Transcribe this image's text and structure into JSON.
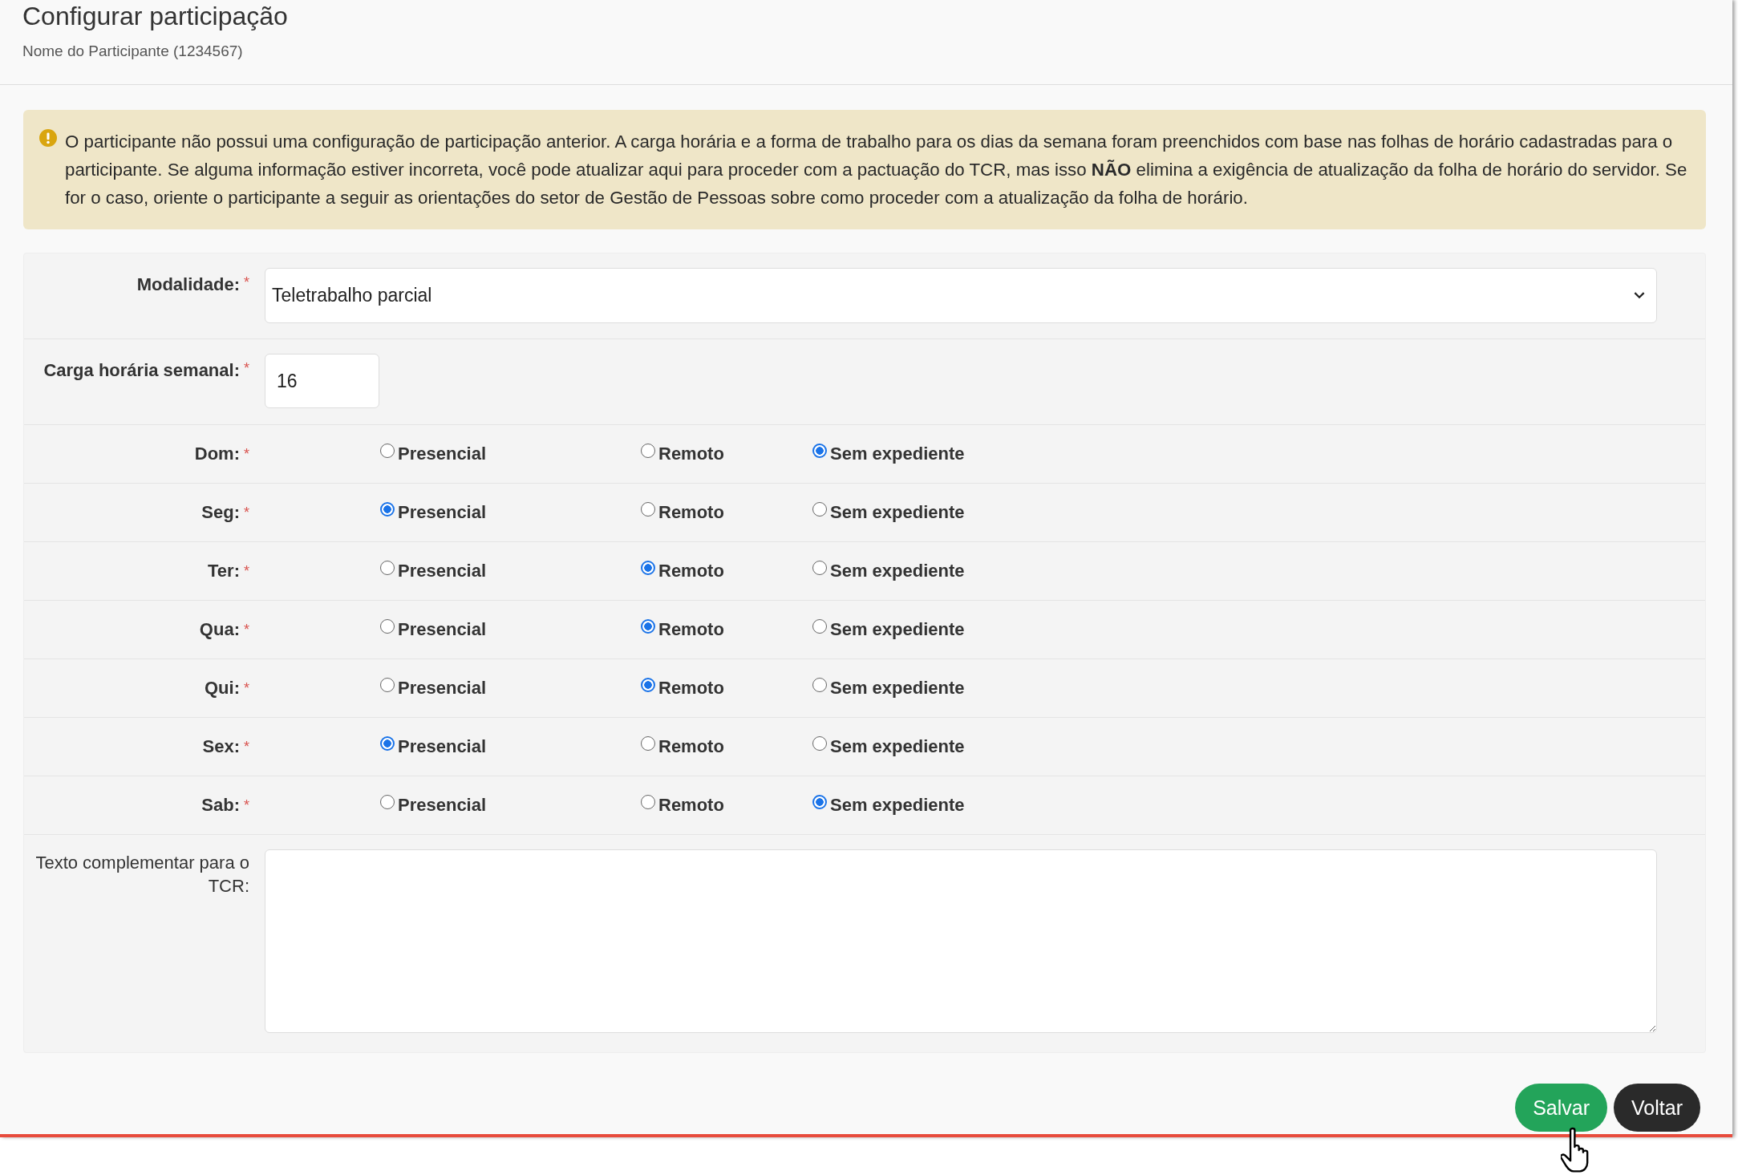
{
  "header": {
    "title": "Configurar participação",
    "subtitle": "Nome do Participante (1234567)"
  },
  "alert": {
    "text": "O participante não possui uma configuração de participação anterior. A carga horária e a forma de trabalho para os dias da semana foram preenchidos com base nas folhas de horário cadastradas para o participante. Se alguma informação estiver incorreta, você pode atualizar aqui para proceder com a pactuação do TCR, mas isso **NÃO** elimina a exigência de atualização da folha de horário do servidor. Se for o caso, oriente o participante a seguir as orientações do setor de Gestão de Pessoas sobre como proceder com a atualização da folha de horário."
  },
  "form": {
    "modalidade": {
      "label": "Modalidade:",
      "required_mark": "*",
      "value": "Teletrabalho parcial"
    },
    "carga": {
      "label": "Carga horária semanal:",
      "required_mark": "*",
      "value": "16"
    },
    "days": [
      {
        "label": "Dom:",
        "required_mark": "*",
        "options": [
          {
            "label": "Presencial",
            "selected": false
          },
          {
            "label": "Remoto",
            "selected": false
          },
          {
            "label": "Sem expediente",
            "selected": true
          }
        ]
      },
      {
        "label": "Seg:",
        "required_mark": "*",
        "options": [
          {
            "label": "Presencial",
            "selected": true
          },
          {
            "label": "Remoto",
            "selected": false
          },
          {
            "label": "Sem expediente",
            "selected": false
          }
        ]
      },
      {
        "label": "Ter:",
        "required_mark": "*",
        "options": [
          {
            "label": "Presencial",
            "selected": false
          },
          {
            "label": "Remoto",
            "selected": true
          },
          {
            "label": "Sem expediente",
            "selected": false
          }
        ]
      },
      {
        "label": "Qua:",
        "required_mark": "*",
        "options": [
          {
            "label": "Presencial",
            "selected": false
          },
          {
            "label": "Remoto",
            "selected": true
          },
          {
            "label": "Sem expediente",
            "selected": false
          }
        ]
      },
      {
        "label": "Qui:",
        "required_mark": "*",
        "options": [
          {
            "label": "Presencial",
            "selected": false
          },
          {
            "label": "Remoto",
            "selected": true
          },
          {
            "label": "Sem expediente",
            "selected": false
          }
        ]
      },
      {
        "label": "Sex:",
        "required_mark": "*",
        "options": [
          {
            "label": "Presencial",
            "selected": true
          },
          {
            "label": "Remoto",
            "selected": false
          },
          {
            "label": "Sem expediente",
            "selected": false
          }
        ]
      },
      {
        "label": "Sab:",
        "required_mark": "*",
        "options": [
          {
            "label": "Presencial",
            "selected": false
          },
          {
            "label": "Remoto",
            "selected": false
          },
          {
            "label": "Sem expediente",
            "selected": true
          }
        ]
      }
    ],
    "texto": {
      "label": "Texto complementar para o TCR:"
    }
  },
  "buttons": [
    {
      "label": "Salvar",
      "kind": "primary"
    },
    {
      "label": "Voltar",
      "kind": "dark"
    }
  ]
}
